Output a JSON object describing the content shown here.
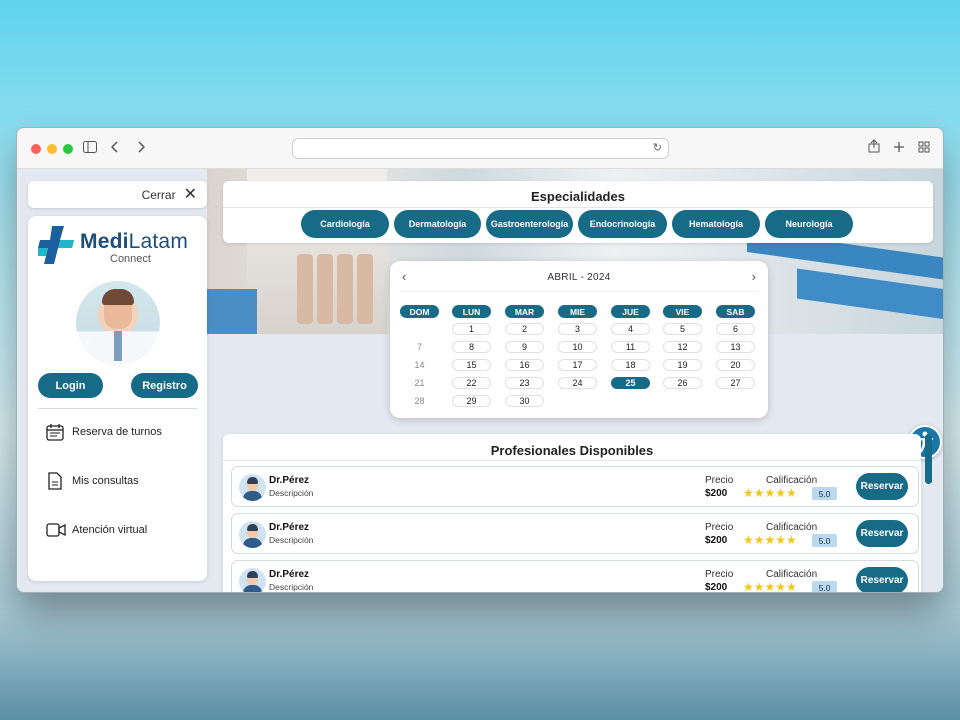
{
  "sidebar_top": {
    "close_label": "Cerrar"
  },
  "brand": {
    "name_part1": "Medi",
    "name_part2": "Latam",
    "sub": "Connect"
  },
  "auth": {
    "login": "Login",
    "registro": "Registro"
  },
  "menu": [
    {
      "label": "Reserva de turnos",
      "icon": "calendar-icon"
    },
    {
      "label": "Mis consultas",
      "icon": "document-icon"
    },
    {
      "label": "Atención virtual",
      "icon": "video-icon"
    }
  ],
  "especialidades": {
    "title": "Especialidades",
    "items": [
      "Cardiología",
      "Dermatología",
      "Gastroenterología",
      "Endocrinología",
      "Hematología",
      "Neurología"
    ]
  },
  "calendar": {
    "month": "ABRIL - 2024",
    "prev": "‹",
    "next": "›",
    "dows": [
      "DOM",
      "LUN",
      "MAR",
      "MIE",
      "JUE",
      "VIE",
      "SAB"
    ],
    "weeks": [
      [
        "",
        "1",
        "2",
        "3",
        "4",
        "5",
        "6"
      ],
      [
        "7",
        "8",
        "9",
        "10",
        "11",
        "12",
        "13"
      ],
      [
        "14",
        "15",
        "16",
        "17",
        "18",
        "19",
        "20"
      ],
      [
        "21",
        "22",
        "23",
        "24",
        "25",
        "26",
        "27"
      ],
      [
        "28",
        "29",
        "30",
        "",
        "",
        "",
        ""
      ]
    ],
    "selected": "25"
  },
  "profesionales": {
    "title": "Profesionales Disponibles",
    "price_label": "Precio",
    "rating_label": "Calificación",
    "action": "Reservar",
    "items": [
      {
        "name": "Dr.Pérez",
        "desc": "Descripción",
        "price": "$200",
        "score": "5.0"
      },
      {
        "name": "Dr.Pérez",
        "desc": "Descripción",
        "price": "$200",
        "score": "5.0"
      },
      {
        "name": "Dr.Pérez",
        "desc": "Descripción",
        "price": "$200",
        "score": "5.0"
      }
    ]
  },
  "colors": {
    "primary": "#176b87",
    "star": "#f3c51b",
    "brand": "#1c4f7a"
  }
}
